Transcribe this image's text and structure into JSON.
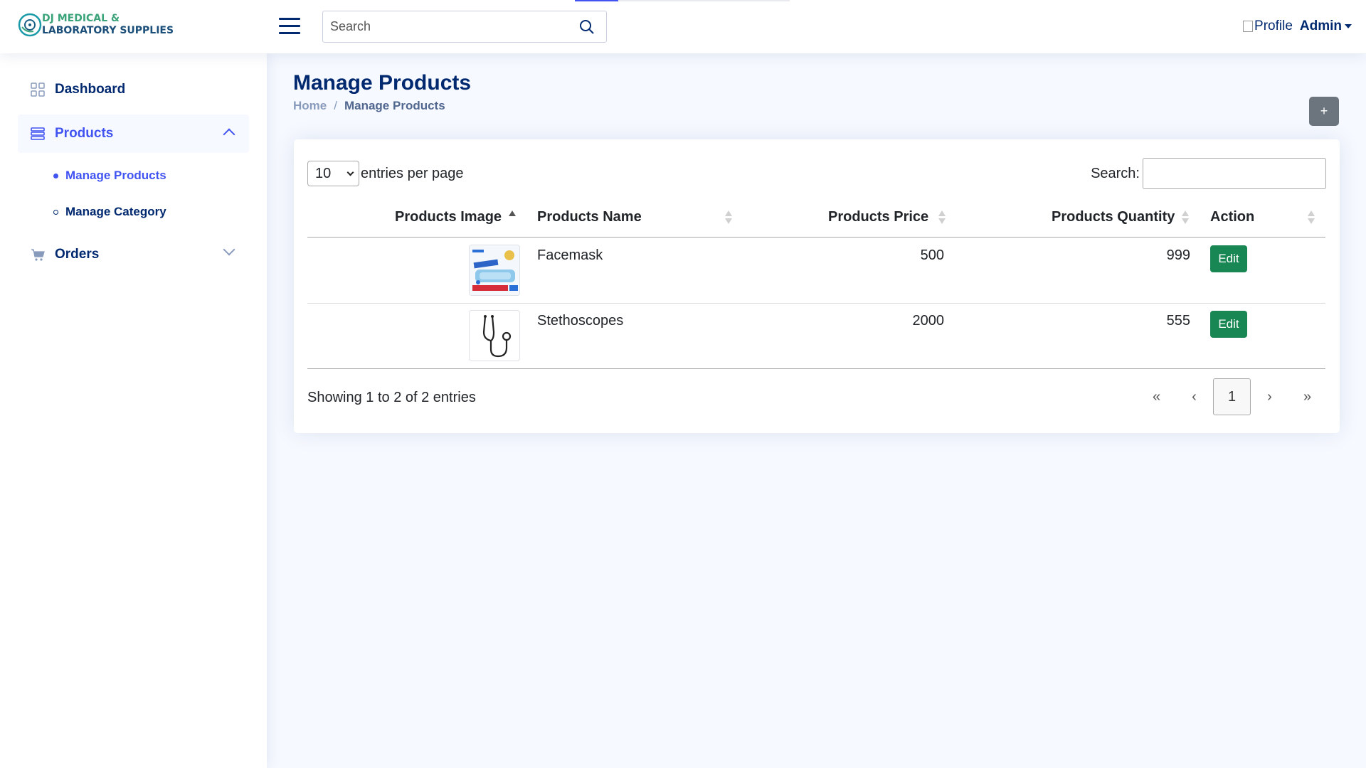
{
  "brand": {
    "line1": "DJ MEDICAL &",
    "line2": "LABORATORY SUPPLIES"
  },
  "header": {
    "search_placeholder": "Search",
    "profile_alt": "Profile",
    "user_name": "Admin"
  },
  "sidebar": {
    "items": [
      {
        "label": "Dashboard",
        "icon": "grid-icon"
      },
      {
        "label": "Products",
        "icon": "layers-icon",
        "expanded": true
      },
      {
        "label": "Orders",
        "icon": "cart-icon",
        "expanded": false
      }
    ],
    "products_sub": [
      {
        "label": "Manage Products",
        "active": true
      },
      {
        "label": "Manage Category",
        "active": false
      }
    ]
  },
  "page": {
    "title": "Manage Products",
    "breadcrumb": [
      "Home",
      "/",
      "Manage Products"
    ],
    "add_label": "+"
  },
  "table": {
    "per_page_value": "10",
    "per_page_label": "entries per page",
    "search_label": "Search:",
    "columns": [
      "Products Image",
      "Products Name",
      "Products Price",
      "Products Quantity",
      "Action"
    ],
    "rows": [
      {
        "image": "facemask-box-thumbnail",
        "name": "Facemask",
        "price": "500",
        "quantity": "999",
        "action": "Edit"
      },
      {
        "image": "stethoscope-thumbnail",
        "name": "Stethoscopes",
        "price": "2000",
        "quantity": "555",
        "action": "Edit"
      }
    ],
    "showing": "Showing 1 to 2 of 2 entries",
    "pagination": [
      "«",
      "‹",
      "1",
      "›",
      "»"
    ]
  },
  "colors": {
    "primary": "#4154f1",
    "navy": "#012970",
    "success": "#198754",
    "secondary": "#6c757d"
  }
}
